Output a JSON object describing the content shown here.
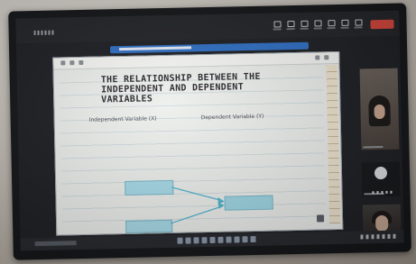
{
  "slide": {
    "heading": [
      "THE RELATIONSHIP BETWEEN THE",
      "INDEPENDENT AND DEPENDENT",
      "VARIABLES"
    ],
    "independent_label": "Independent Variable (X)",
    "dependent_label": "Dependent Variable (Y)"
  },
  "colors": {
    "box_fill": "#a8dcea",
    "arrow": "#4fb6cf",
    "leave_button": "#d6463c",
    "share_banner": "#2f6fc4"
  }
}
